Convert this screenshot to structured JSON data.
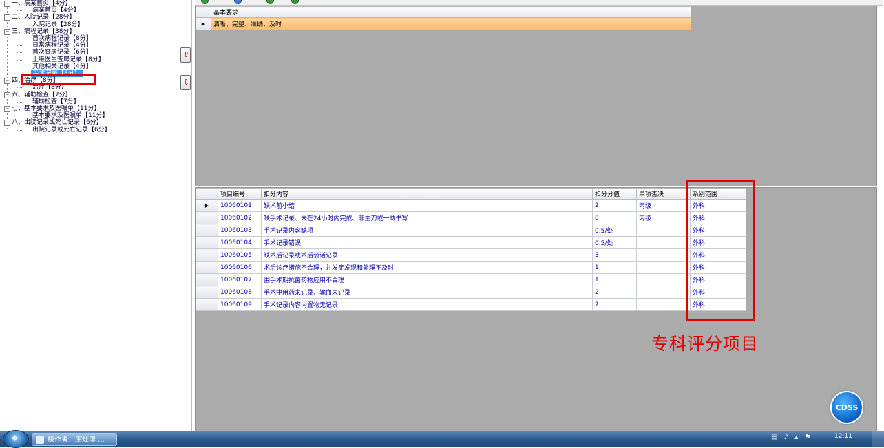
{
  "tree": {
    "items": [
      {
        "label": "一、病案首页【4分】",
        "level": 0,
        "expander": "−"
      },
      {
        "label": "病案首页【4分】",
        "level": 1
      },
      {
        "label": "二、入院记录【28分】",
        "level": 0,
        "expander": "−"
      },
      {
        "label": "入院记录【28分】",
        "level": 1
      },
      {
        "label": "三、病程记录【38分】",
        "level": 0,
        "expander": "−"
      },
      {
        "label": "首次病程记录【8分】",
        "level": 1
      },
      {
        "label": "日常病程记录【4分】",
        "level": 1
      },
      {
        "label": "首次查房记录【6分】",
        "level": 1
      },
      {
        "label": "上级医生查房记录【8分】",
        "level": 1
      },
      {
        "label": "其他相关记录【4分】",
        "level": 1
      },
      {
        "label": "手术记录【8分】",
        "level": 1,
        "selected": true
      },
      {
        "label": "四、治疗【8分】",
        "level": 0,
        "expander": "−"
      },
      {
        "label": "治疗【8分】",
        "level": 1
      },
      {
        "label": "六、辅助检查【7分】",
        "level": 0,
        "expander": "−"
      },
      {
        "label": "辅助检查【7分】",
        "level": 1
      },
      {
        "label": "七、基本要求及医嘱单【11分】",
        "level": 0,
        "expander": "−"
      },
      {
        "label": "基本要求及医嘱单【11分】",
        "level": 1
      },
      {
        "label": "八、出院记录或死亡记录【6分】",
        "level": 0,
        "expander": "−"
      },
      {
        "label": "出院记录或死亡记录【6分】",
        "level": 1
      }
    ]
  },
  "move_up_icon": "arrow-up-icon",
  "move_down_icon": "arrow-down-icon",
  "top_grid": {
    "header": "基本要求",
    "rows": [
      "清晰、完整、准确、及时"
    ]
  },
  "bottom_grid": {
    "headers": [
      "项目编号",
      "扣分内容",
      "扣分分值",
      "单项否决",
      "系别范围"
    ],
    "rows": [
      [
        "10060101",
        "缺术前小结",
        "2",
        "丙级",
        "外科"
      ],
      [
        "10060102",
        "缺手术记录、未在24小时内完成、非主刀或一助书写",
        "8",
        "丙级",
        "外科"
      ],
      [
        "10060103",
        "手术记录内容缺项",
        "0.5/处",
        "",
        "外科"
      ],
      [
        "10060104",
        "手术记录错误",
        "0.5/处",
        "",
        "外科"
      ],
      [
        "10060105",
        "缺术后记录或术后谈话记录",
        "3",
        "",
        "外科"
      ],
      [
        "10060106",
        "术后诊疗措施不合理，并发症发现和处理不及时",
        "1",
        "",
        "外科"
      ],
      [
        "10060107",
        "围手术期抗菌药物应用不合理",
        "1",
        "",
        "外科"
      ],
      [
        "10060108",
        "手术中用药未记录、输血未记录",
        "2",
        "",
        "外科"
      ],
      [
        "10060109",
        "手术记录内容内置物无记录",
        "2",
        "",
        "外科"
      ]
    ]
  },
  "annotation": "专科评分项目",
  "cdss_label": "CDSS",
  "taskbar": {
    "task_label": "操作者：庄灶津 ...",
    "clock": "12:11"
  },
  "colors": {
    "highlight": "#e00000",
    "selection": "#3399ff",
    "row_highlight": "#ffb865"
  }
}
